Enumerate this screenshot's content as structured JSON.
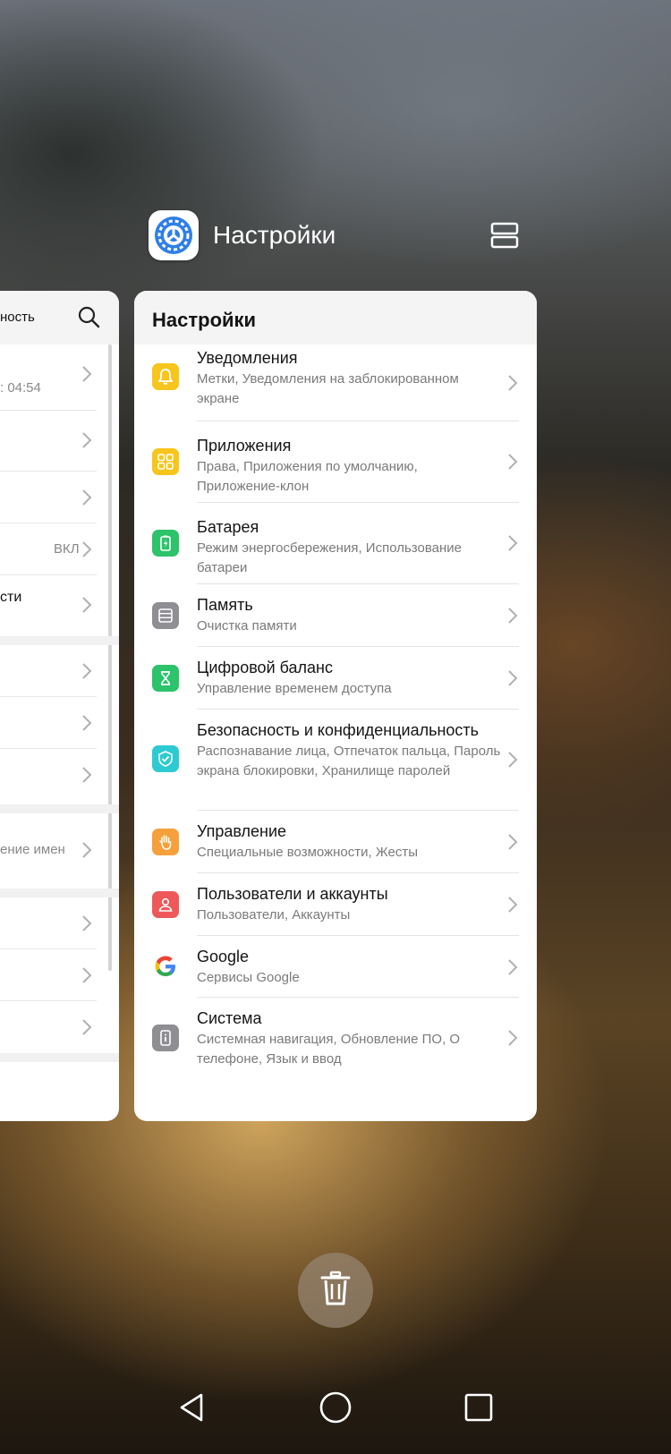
{
  "header": {
    "app_name": "Настройки",
    "app_icon": "settings-gear-icon",
    "split_screen_icon": "split-screen-icon"
  },
  "left_card": {
    "title_fragment": "ность",
    "search_icon": "search-icon",
    "rows": [
      {
        "text": ": 04:54"
      },
      {
        "text": ""
      },
      {
        "text": ""
      },
      {
        "text": "ВКЛ"
      },
      {
        "text": "сти"
      },
      {
        "text": ""
      },
      {
        "text": ""
      },
      {
        "text": ""
      },
      {
        "text": "ение имен"
      },
      {
        "text": ""
      },
      {
        "text": ""
      },
      {
        "text": ""
      }
    ]
  },
  "settings": {
    "title": "Настройки",
    "items": [
      {
        "title": "Уведомления",
        "subtitle": "Метки, Уведомления на заблокированном экране",
        "icon": "bell-icon",
        "color": "#F7C51B"
      },
      {
        "title": "Приложения",
        "subtitle": "Права, Приложения по умолчанию, Приложение-клон",
        "icon": "apps-grid-icon",
        "color": "#F7C51B"
      },
      {
        "title": "Батарея",
        "subtitle": "Режим энергосбережения, Использование батареи",
        "icon": "battery-icon",
        "color": "#2CC36B"
      },
      {
        "title": "Память",
        "subtitle": "Очистка памяти",
        "icon": "storage-icon",
        "color": "#8E8E93"
      },
      {
        "title": "Цифровой баланс",
        "subtitle": "Управление временем доступа",
        "icon": "hourglass-icon",
        "color": "#2CC36B"
      },
      {
        "title": "Безопасность и конфиденциальность",
        "subtitle": "Распознавание лица, Отпечаток пальца, Пароль экрана блокировки, Хранилище паролей",
        "icon": "shield-icon",
        "color": "#2ECAD2"
      },
      {
        "title": "Управление",
        "subtitle": "Специальные возможности, Жесты",
        "icon": "hand-icon",
        "color": "#F6A03C"
      },
      {
        "title": "Пользователи и аккаунты",
        "subtitle": "Пользователи, Аккаунты",
        "icon": "user-icon",
        "color": "#EF5858"
      },
      {
        "title": "Google",
        "subtitle": "Сервисы Google",
        "icon": "google-icon",
        "color": "#FFFFFF"
      },
      {
        "title": "Система",
        "subtitle": "Системная навигация, Обновление ПО, О телефоне, Язык и ввод",
        "icon": "phone-info-icon",
        "color": "#8E8E93"
      }
    ]
  },
  "trash_icon": "trash-icon",
  "nav": {
    "back_icon": "back-icon",
    "home_icon": "home-icon",
    "recents_icon": "recents-icon"
  }
}
